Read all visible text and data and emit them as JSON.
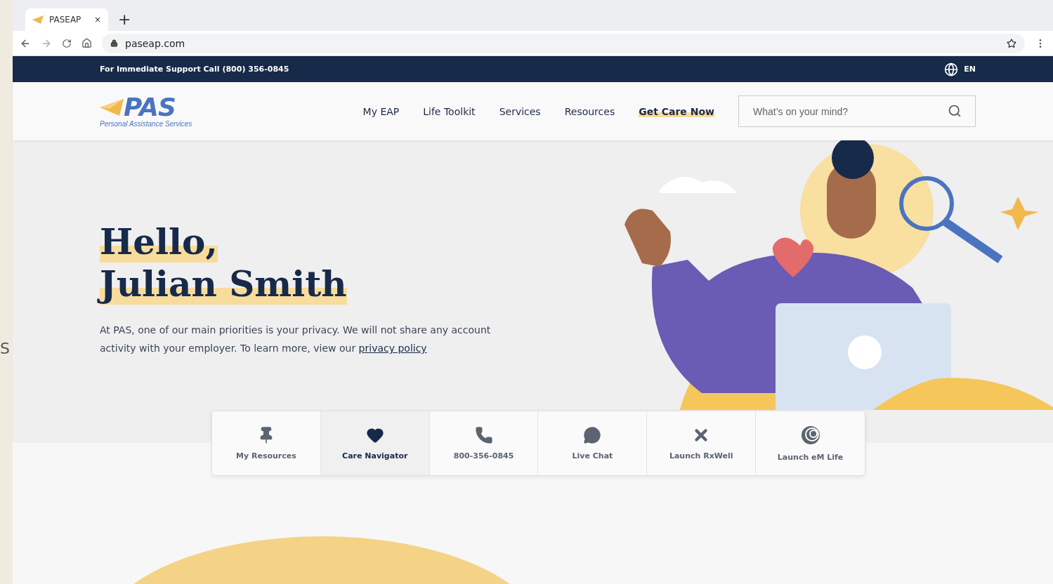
{
  "edge_text": "S",
  "browser": {
    "tab_title": "PASEAP",
    "tab_close": "×",
    "new_tab": "+",
    "url": "paseap.com"
  },
  "support_bar": {
    "text": "For Immediate Support Call (800) 356-0845",
    "language": "EN"
  },
  "header": {
    "logo_mark": "PAS",
    "logo_tagline": "Personal Assistance Services",
    "nav": [
      {
        "label": "My EAP",
        "selected": false
      },
      {
        "label": "Life Toolkit",
        "selected": false
      },
      {
        "label": "Services",
        "selected": false
      },
      {
        "label": "Resources",
        "selected": false
      },
      {
        "label": "Get Care Now",
        "selected": true
      }
    ],
    "search": {
      "placeholder": "What’s on your mind?"
    }
  },
  "hero": {
    "greeting": "Hello,",
    "name": "Julian Smith",
    "text": "At PAS, one of our main priorities is your privacy. We will not share any account activity with your employer. To learn more, view our",
    "link": "privacy policy"
  },
  "quick_links": [
    {
      "kind": "pin",
      "label": "My Resources",
      "selected": false
    },
    {
      "kind": "heart",
      "label": "Care Navigator",
      "selected": true
    },
    {
      "kind": "phone",
      "label": "800-356-0845",
      "selected": false
    },
    {
      "kind": "chat",
      "label": "Live Chat",
      "selected": false
    },
    {
      "kind": "x",
      "label": "Launch RxWell",
      "selected": false
    },
    {
      "kind": "rings",
      "label": "Launch eM Life",
      "selected": false
    }
  ]
}
